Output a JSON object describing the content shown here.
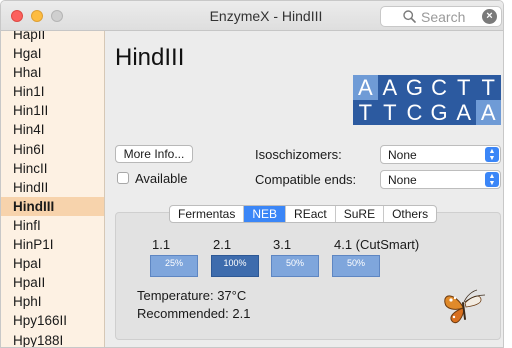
{
  "window": {
    "title": "EnzymeX - HindIII"
  },
  "search": {
    "placeholder": "Search"
  },
  "sidebar": {
    "items": [
      {
        "label": "HapII",
        "selected": false
      },
      {
        "label": "HgaI",
        "selected": false
      },
      {
        "label": "HhaI",
        "selected": false
      },
      {
        "label": "Hin1I",
        "selected": false
      },
      {
        "label": "Hin1II",
        "selected": false
      },
      {
        "label": "Hin4I",
        "selected": false
      },
      {
        "label": "Hin6I",
        "selected": false
      },
      {
        "label": "HincII",
        "selected": false
      },
      {
        "label": "HindII",
        "selected": false
      },
      {
        "label": "HindIII",
        "selected": true
      },
      {
        "label": "HinfI",
        "selected": false
      },
      {
        "label": "HinP1I",
        "selected": false
      },
      {
        "label": "HpaI",
        "selected": false
      },
      {
        "label": "HpaII",
        "selected": false
      },
      {
        "label": "HphI",
        "selected": false
      },
      {
        "label": "Hpy166II",
        "selected": false
      },
      {
        "label": "Hpy188I",
        "selected": false
      }
    ]
  },
  "enzyme": {
    "name": "HindIII",
    "sequence_top": [
      "A",
      "A",
      "G",
      "C",
      "T",
      "T"
    ],
    "sequence_bottom": [
      "T",
      "T",
      "C",
      "G",
      "A",
      "A"
    ]
  },
  "actions": {
    "more_info": "More Info...",
    "available_label": "Available",
    "available_checked": false
  },
  "fields": {
    "isoschizomers_label": "Isoschizomers:",
    "isoschizomers_value": "None",
    "compatible_label": "Compatible ends:",
    "compatible_value": "None"
  },
  "tabs": [
    {
      "label": "Fermentas",
      "active": false
    },
    {
      "label": "NEB",
      "active": true
    },
    {
      "label": "REact",
      "active": false
    },
    {
      "label": "SuRE",
      "active": false
    },
    {
      "label": "Others",
      "active": false
    }
  ],
  "buffers": [
    {
      "name": "1.1",
      "activity": "25%"
    },
    {
      "name": "2.1",
      "activity": "100%"
    },
    {
      "name": "3.1",
      "activity": "50%"
    },
    {
      "name": "4.1 (CutSmart)",
      "activity": "50%"
    }
  ],
  "conditions": {
    "temperature": "Temperature: 37°C",
    "recommended": "Recommended: 2.1"
  },
  "colors": {
    "sidebar_bg": "#fdf1e3",
    "sidebar_selected": "#f7d3ac",
    "seq_dark": "#2c5aa0",
    "seq_light": "#6f9bd6",
    "accent": "#3b86f7"
  },
  "icons": {
    "search": "search-icon",
    "clear": "clear-icon",
    "logo": "butterfly-icon"
  }
}
